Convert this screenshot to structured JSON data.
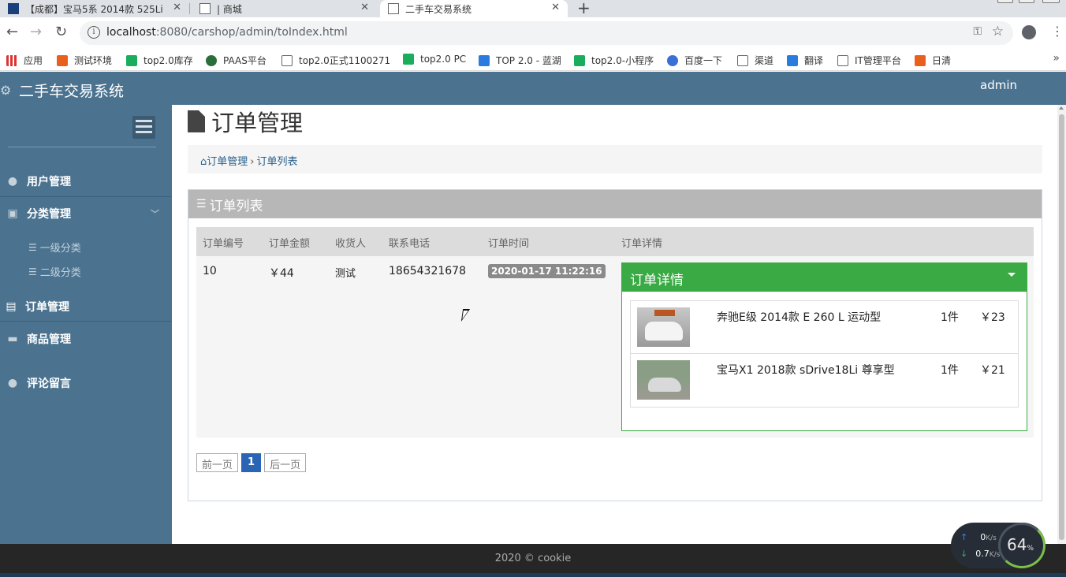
{
  "browser": {
    "tabs": [
      {
        "title": "【成都】宝马5系 2014款 525Li",
        "active": false
      },
      {
        "title": "| 商城",
        "active": false
      },
      {
        "title": "二手车交易系统",
        "active": true
      }
    ],
    "url_host": "localhost",
    "url_path": ":8080/carshop/admin/toIndex.html",
    "bookmarks": [
      "应用",
      "测试环境",
      "top2.0库存",
      "PAAS平台",
      "top2.0正式1100271",
      "top2.0 PC",
      "TOP 2.0 - 蓝湖",
      "top2.0-小程序",
      "百度一下",
      "渠道",
      "翻译",
      "IT管理平台",
      "日清"
    ]
  },
  "app": {
    "brand": "二手车交易系统",
    "user": "admin",
    "colors": {
      "header": "#4b7390",
      "panel_head": "#b7b7b7",
      "detail_head": "#3aaa44",
      "pager_active": "#2a65b5"
    }
  },
  "sidebar": {
    "items": [
      {
        "label": "用户管理",
        "icon": "user-icon"
      },
      {
        "label": "分类管理",
        "icon": "category-icon"
      },
      {
        "label": "订单管理",
        "icon": "document-icon"
      },
      {
        "label": "商品管理",
        "icon": "briefcase-icon"
      },
      {
        "label": "评论留言",
        "icon": "user-icon"
      }
    ],
    "sub_items": [
      "一级分类",
      "二级分类"
    ]
  },
  "page": {
    "title": "订单管理",
    "breadcrumb": {
      "root": "订单管理",
      "current": "订单列表"
    },
    "panel_title": "订单列表"
  },
  "table": {
    "headers": [
      "订单编号",
      "订单金额",
      "收货人",
      "联系电话",
      "订单时间",
      "订单详情"
    ],
    "row": {
      "id": "10",
      "amount": "￥44",
      "receiver": "测试",
      "phone": "18654321678",
      "time": "2020-01-17 11:22:16"
    },
    "detail_title": "订单详情",
    "products": [
      {
        "name": "奔驰E级 2014款 E 260 L 运动型",
        "qty": "1件",
        "price": "￥23"
      },
      {
        "name": "宝马X1 2018款 sDrive18Li 尊享型",
        "qty": "1件",
        "price": "￥21"
      }
    ]
  },
  "pager": {
    "prev": "前一页",
    "current": "1",
    "next": "后一页"
  },
  "footer": "2020 © cookie",
  "net_widget": {
    "up": "0",
    "down": "0.7",
    "unit": "K/s",
    "percent": "64",
    "percent_sign": "%"
  }
}
